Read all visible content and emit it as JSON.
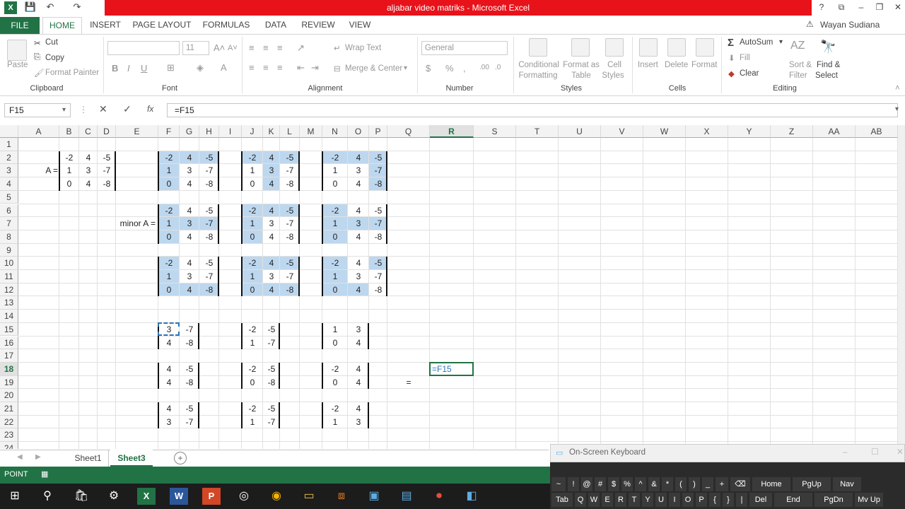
{
  "window": {
    "title": "aljabar video matriks - Microsoft Excel",
    "user": "Wayan Sudiana",
    "controls": [
      "?",
      "⧉",
      "–",
      "❐",
      "✕"
    ]
  },
  "tabs": [
    "FILE",
    "HOME",
    "INSERT",
    "PAGE LAYOUT",
    "FORMULAS",
    "DATA",
    "REVIEW",
    "VIEW"
  ],
  "ribbon": {
    "clipboard": {
      "paste": "Paste",
      "cut": "Cut",
      "copy": "Copy",
      "format_painter": "Format Painter",
      "label": "Clipboard"
    },
    "font": {
      "size": "11",
      "label": "Font"
    },
    "alignment": {
      "wrap": "Wrap Text",
      "merge": "Merge & Center",
      "label": "Alignment"
    },
    "number": {
      "format": "General",
      "label": "Number"
    },
    "styles": {
      "cond": "Conditional",
      "cond2": "Formatting",
      "fmt_table": "Format as",
      "fmt_table2": "Table",
      "cell_styles": "Cell",
      "cell_styles2": "Styles",
      "label": "Styles"
    },
    "cells": {
      "insert": "Insert",
      "delete": "Delete",
      "format": "Format",
      "label": "Cells"
    },
    "editing": {
      "autosum": "AutoSum",
      "fill": "Fill",
      "clear": "Clear",
      "sort": "Sort &",
      "sort2": "Filter",
      "find": "Find &",
      "find2": "Select",
      "label": "Editing"
    }
  },
  "formula_bar": {
    "name_box": "F15",
    "formula": "=F15"
  },
  "columns": [
    "A",
    "B",
    "C",
    "D",
    "E",
    "F",
    "G",
    "H",
    "I",
    "J",
    "K",
    "L",
    "M",
    "N",
    "O",
    "P",
    "Q",
    "R",
    "S",
    "T",
    "U",
    "V",
    "W",
    "X",
    "Y",
    "Z",
    "AA",
    "AB"
  ],
  "rows": [
    "1",
    "2",
    "3",
    "4",
    "5",
    "6",
    "7",
    "8",
    "9",
    "10",
    "11",
    "12",
    "13",
    "14",
    "15",
    "16",
    "17",
    "18",
    "19",
    "20",
    "21",
    "22",
    "23",
    "24"
  ],
  "active_column": "R",
  "active_row": "18",
  "cells": {
    "A3": "A =",
    "E7": "minor A =",
    "Q19": "=",
    "R18": "=F15",
    "B2": "-2",
    "C2": "4",
    "D2": "-5",
    "B3": "1",
    "C3": "3",
    "D3": "-7",
    "B4": "0",
    "C4": "4",
    "D4": "-8",
    "F2": "-2",
    "G2": "4",
    "H2": "-5",
    "F3": "1",
    "G3": "3",
    "H3": "-7",
    "F4": "0",
    "G4": "4",
    "H4": "-8",
    "J2": "-2",
    "K2": "4",
    "L2": "-5",
    "J3": "1",
    "K3": "3",
    "L3": "-7",
    "J4": "0",
    "K4": "4",
    "L4": "-8",
    "N2": "-2",
    "O2": "4",
    "P2": "-5",
    "N3": "1",
    "O3": "3",
    "P3": "-7",
    "N4": "0",
    "O4": "4",
    "P4": "-8",
    "F6": "-2",
    "G6": "4",
    "H6": "-5",
    "F7": "1",
    "G7": "3",
    "H7": "-7",
    "F8": "0",
    "G8": "4",
    "H8": "-8",
    "J6": "-2",
    "K6": "4",
    "L6": "-5",
    "J7": "1",
    "K7": "3",
    "L7": "-7",
    "J8": "0",
    "K8": "4",
    "L8": "-8",
    "N6": "-2",
    "O6": "4",
    "P6": "-5",
    "N7": "1",
    "O7": "3",
    "P7": "-7",
    "N8": "0",
    "O8": "4",
    "P8": "-8",
    "F10": "-2",
    "G10": "4",
    "H10": "-5",
    "F11": "1",
    "G11": "3",
    "H11": "-7",
    "F12": "0",
    "G12": "4",
    "H12": "-8",
    "J10": "-2",
    "K10": "4",
    "L10": "-5",
    "J11": "1",
    "K11": "3",
    "L11": "-7",
    "J12": "0",
    "K12": "4",
    "L12": "-8",
    "N10": "-2",
    "O10": "4",
    "P10": "-5",
    "N11": "1",
    "O11": "3",
    "P11": "-7",
    "N12": "0",
    "O12": "4",
    "P12": "-8",
    "F15": "3",
    "G15": "-7",
    "F16": "4",
    "G16": "-8",
    "J15": "-2",
    "K15": "-5",
    "J16": "1",
    "K16": "-7",
    "N15": "1",
    "O15": "3",
    "N16": "0",
    "O16": "4",
    "F18": "4",
    "G18": "-5",
    "F19": "4",
    "G19": "-8",
    "J18": "-2",
    "K18": "-5",
    "J19": "0",
    "K19": "-8",
    "N18": "-2",
    "O18": "4",
    "N19": "0",
    "O19": "4",
    "F21": "4",
    "G21": "-5",
    "F22": "3",
    "G22": "-7",
    "J21": "-2",
    "K21": "-5",
    "J22": "1",
    "K22": "-7",
    "N21": "-2",
    "O21": "4",
    "N22": "1",
    "O22": "3"
  },
  "highlighted": [
    "F2",
    "G2",
    "H2",
    "F3",
    "F4",
    "J2",
    "K2",
    "L2",
    "K3",
    "K4",
    "N2",
    "O2",
    "P2",
    "P3",
    "P4",
    "F6",
    "F7",
    "F8",
    "G7",
    "H7",
    "J6",
    "J7",
    "J8",
    "K6",
    "L6",
    "N6",
    "N7",
    "N8",
    "O7",
    "P7",
    "F10",
    "F11",
    "F12",
    "G12",
    "H12",
    "J10",
    "J11",
    "J12",
    "K10",
    "L10",
    "K12",
    "L12",
    "N10",
    "N11",
    "N12",
    "O12",
    "P10"
  ],
  "sheets": [
    "Sheet1",
    "Sheet3"
  ],
  "active_sheet": "Sheet3",
  "status": "POINT",
  "osk": {
    "title": "On-Screen Keyboard",
    "row1": [
      "~",
      "!",
      "@",
      "#",
      "$",
      "%",
      "^",
      "&",
      "*",
      "(",
      ")",
      "_",
      "+",
      "⌫",
      "Home",
      "PgUp",
      "Nav"
    ],
    "row2": [
      "Tab",
      "Q",
      "W",
      "E",
      "R",
      "T",
      "Y",
      "U",
      "I",
      "O",
      "P",
      "{",
      "}",
      "|",
      "Del",
      "End",
      "PgDn",
      "Mv Up"
    ]
  },
  "colors": {
    "excel_green": "#217346",
    "title_red": "#e8121a",
    "highlight": "#bdd7ee"
  }
}
